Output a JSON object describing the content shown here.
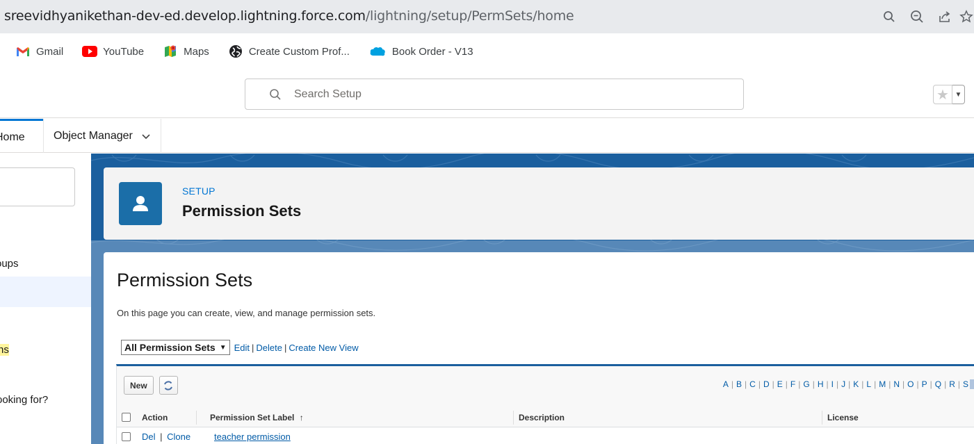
{
  "browser": {
    "url_host": "sreevidhyanikethan-dev-ed.develop.lightning.force.com",
    "url_path": "/lightning/setup/PermSets/home",
    "icons": [
      "search-icon",
      "zoom-out-icon",
      "share-icon",
      "star-icon"
    ]
  },
  "bookmarks": [
    {
      "label": "Gmail",
      "icon": "gmail-icon"
    },
    {
      "label": "YouTube",
      "icon": "youtube-icon"
    },
    {
      "label": "Maps",
      "icon": "maps-icon"
    },
    {
      "label": "Create Custom Prof...",
      "icon": "globe-icon"
    },
    {
      "label": "Book Order - V13",
      "icon": "salesforce-cloud-icon"
    }
  ],
  "header": {
    "search_placeholder": "Search Setup"
  },
  "nav": {
    "home_label": "Home",
    "object_manager_label": "Object Manager"
  },
  "sidebar": {
    "items": [
      {
        "label": "oups"
      },
      {
        "label": "ns"
      },
      {
        "label": "ooking for?"
      }
    ]
  },
  "page_header": {
    "eyebrow": "SETUP",
    "title": "Permission Sets"
  },
  "content": {
    "heading": "Permission Sets",
    "description": "On this page you can create, view, and manage permission sets.",
    "view_select": "All Permission Sets",
    "view_links": {
      "edit": "Edit",
      "delete": "Delete",
      "create": "Create New View"
    },
    "new_button": "New",
    "alphabet": [
      "A",
      "B",
      "C",
      "D",
      "E",
      "F",
      "G",
      "H",
      "I",
      "J",
      "K",
      "L",
      "M",
      "N",
      "O",
      "P",
      "Q",
      "R",
      "S"
    ],
    "columns": {
      "action": "Action",
      "label": "Permission Set Label",
      "sort_indicator": "↑",
      "description": "Description",
      "license": "License"
    },
    "rows": [
      {
        "del": "Del",
        "clone": "Clone",
        "label": "teacher permission",
        "description": "",
        "license": ""
      }
    ]
  },
  "colors": {
    "brand_blue": "#0176d3",
    "header_band": "#1b5f9e",
    "link": "#015ba7"
  }
}
